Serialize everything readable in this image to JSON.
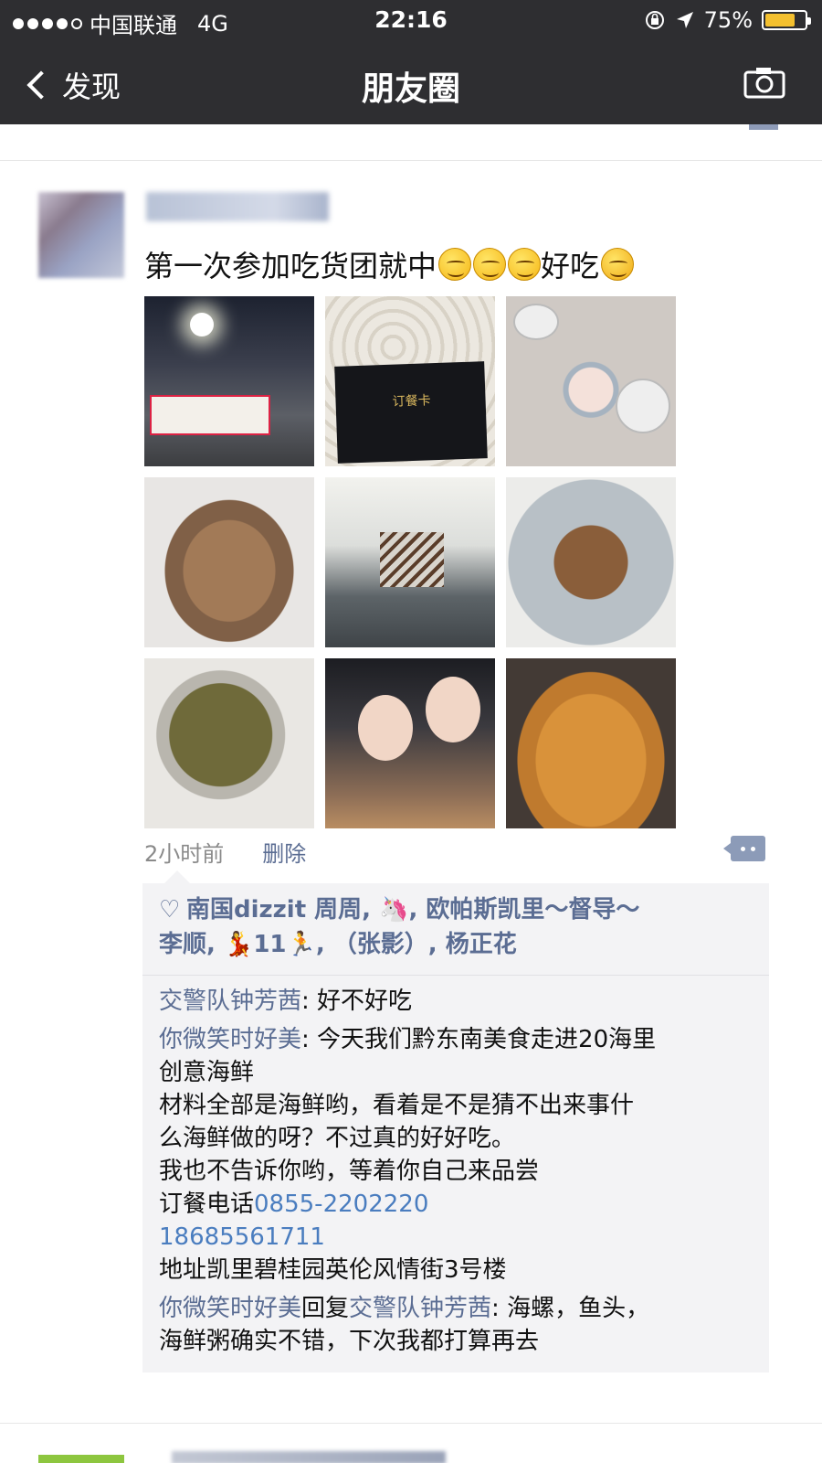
{
  "status_bar": {
    "carrier": "中国联通",
    "network": "4G",
    "time": "22:16",
    "battery_percent": "75%",
    "battery_level": 0.75,
    "signal_dots_filled": 4,
    "signal_dots_total": 5
  },
  "nav": {
    "back_label": "发现",
    "title": "朋友圈",
    "camera_icon": "camera-icon"
  },
  "post": {
    "text": "第一次参加吃货团就中",
    "text_suffix": "好吃",
    "emojis": [
      "blush-emoji",
      "blush-emoji",
      "blush-emoji",
      "thinking-emoji"
    ],
    "time_ago": "2小时前",
    "delete_label": "删除",
    "photos": [
      "group-photo-banner",
      "menu-card-photo",
      "table-dishes-photo",
      "fried-mantis-shrimp-photo",
      "restaurant-interior-photo",
      "razor-clam-plate-photo",
      "clay-pot-stir-fry-photo",
      "selfie-two-girls-photo",
      "fried-seafood-photo"
    ],
    "tile2_text": "订餐卡"
  },
  "likes": {
    "line1": "南国dizzit 周周, ",
    "line1b": ", 欧帕斯凯里～督导～",
    "line2a": "李顺, ",
    "line2b": "11",
    "line2c": ", （张影）, 杨正花"
  },
  "comments": {
    "c1_name": "交警队钟芳茜",
    "c1_text": ": 好不好吃",
    "c2_name": "你微笑时好美",
    "c2_line1": ": 今天我们黔东南美食走进20海里",
    "c2_line2": "创意海鲜",
    "c2_line3": "材料全部是海鲜哟，看着是不是猜不出来事什",
    "c2_line4": "么海鲜做的呀？不过真的好好吃。",
    "c2_line5": "我也不告诉你哟，等着你自己来品尝",
    "c2_line6_prefix": "订餐电话",
    "c2_phone1": "0855-2202220",
    "c2_phone2": "18685561711",
    "c2_line8": "地址凯里碧桂园英伦风情街3号楼",
    "c3_name": "你微笑时好美",
    "c3_reply": "回复",
    "c3_target": "交警队钟芳茜",
    "c3_line1": ": 海螺，鱼头，",
    "c3_line2": "海鲜粥确实不错，下次我都打算再去"
  },
  "colors": {
    "nav_bg": "#2e2e31",
    "name_link": "#5b6d93",
    "phone_link": "#4a7dbf",
    "battery": "#f4c02f"
  }
}
